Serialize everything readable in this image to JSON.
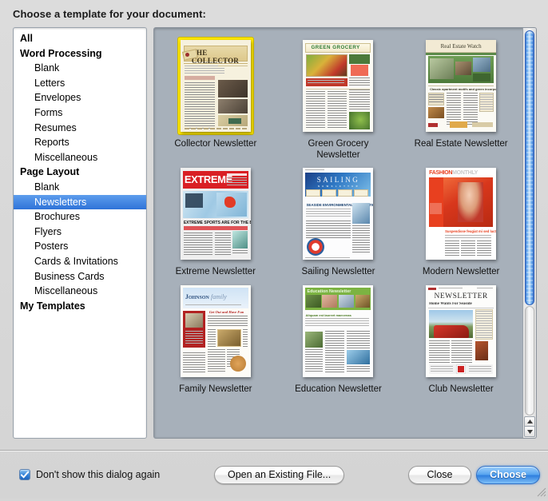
{
  "dialog": {
    "prompt": "Choose a template for your document:"
  },
  "sidebar": {
    "items": [
      {
        "label": "All",
        "level": "group",
        "selected": false
      },
      {
        "label": "Word Processing",
        "level": "group",
        "selected": false
      },
      {
        "label": "Blank",
        "level": "child",
        "selected": false
      },
      {
        "label": "Letters",
        "level": "child",
        "selected": false
      },
      {
        "label": "Envelopes",
        "level": "child",
        "selected": false
      },
      {
        "label": "Forms",
        "level": "child",
        "selected": false
      },
      {
        "label": "Resumes",
        "level": "child",
        "selected": false
      },
      {
        "label": "Reports",
        "level": "child",
        "selected": false
      },
      {
        "label": "Miscellaneous",
        "level": "child",
        "selected": false
      },
      {
        "label": "Page Layout",
        "level": "group",
        "selected": false
      },
      {
        "label": "Blank",
        "level": "child",
        "selected": false
      },
      {
        "label": "Newsletters",
        "level": "child",
        "selected": true
      },
      {
        "label": "Brochures",
        "level": "child",
        "selected": false
      },
      {
        "label": "Flyers",
        "level": "child",
        "selected": false
      },
      {
        "label": "Posters",
        "level": "child",
        "selected": false
      },
      {
        "label": "Cards & Invitations",
        "level": "child",
        "selected": false
      },
      {
        "label": "Business Cards",
        "level": "child",
        "selected": false
      },
      {
        "label": "Miscellaneous",
        "level": "child",
        "selected": false
      },
      {
        "label": "My Templates",
        "level": "group",
        "selected": false
      }
    ]
  },
  "templates": {
    "rows": [
      [
        {
          "label": "Collector Newsletter",
          "art": "collector",
          "selected": true,
          "masthead": "THE COLLECTOR"
        },
        {
          "label": "Green Grocery Newsletter",
          "art": "grocery",
          "selected": false,
          "masthead": "GREEN GROCERY"
        },
        {
          "label": "Real Estate Newsletter",
          "art": "realestate",
          "selected": false,
          "masthead": "Real Estate Watch"
        }
      ],
      [
        {
          "label": "Extreme Newsletter",
          "art": "extreme",
          "selected": false,
          "masthead": "EXTREME"
        },
        {
          "label": "Sailing Newsletter",
          "art": "sailing",
          "selected": false,
          "masthead": "SAILING"
        },
        {
          "label": "Modern Newsletter",
          "art": "modern",
          "selected": false,
          "masthead": "FASHION MONTHLY"
        }
      ],
      [
        {
          "label": "Family Newsletter",
          "art": "family",
          "selected": false,
          "masthead": "JOHNSON family"
        },
        {
          "label": "Education Newsletter",
          "art": "education",
          "selected": false,
          "masthead": "Education Newsletter"
        },
        {
          "label": "Club Newsletter",
          "art": "club",
          "selected": false,
          "masthead": "NEWSLETTER"
        }
      ]
    ]
  },
  "scrollbar": {
    "orientation": "vertical",
    "thumb_position_percent": 0,
    "thumb_size_percent": 74
  },
  "footer": {
    "dont_show_label": "Don't show this dialog again",
    "dont_show_checked": true,
    "open_existing_label": "Open an Existing File...",
    "close_label": "Close",
    "choose_label": "Choose"
  },
  "colors": {
    "selection_blue": "#2f73d8",
    "selection_yellow": "#ffe800",
    "default_button_blue": "#2f7fdf",
    "grid_background": "#a7b0ba"
  }
}
